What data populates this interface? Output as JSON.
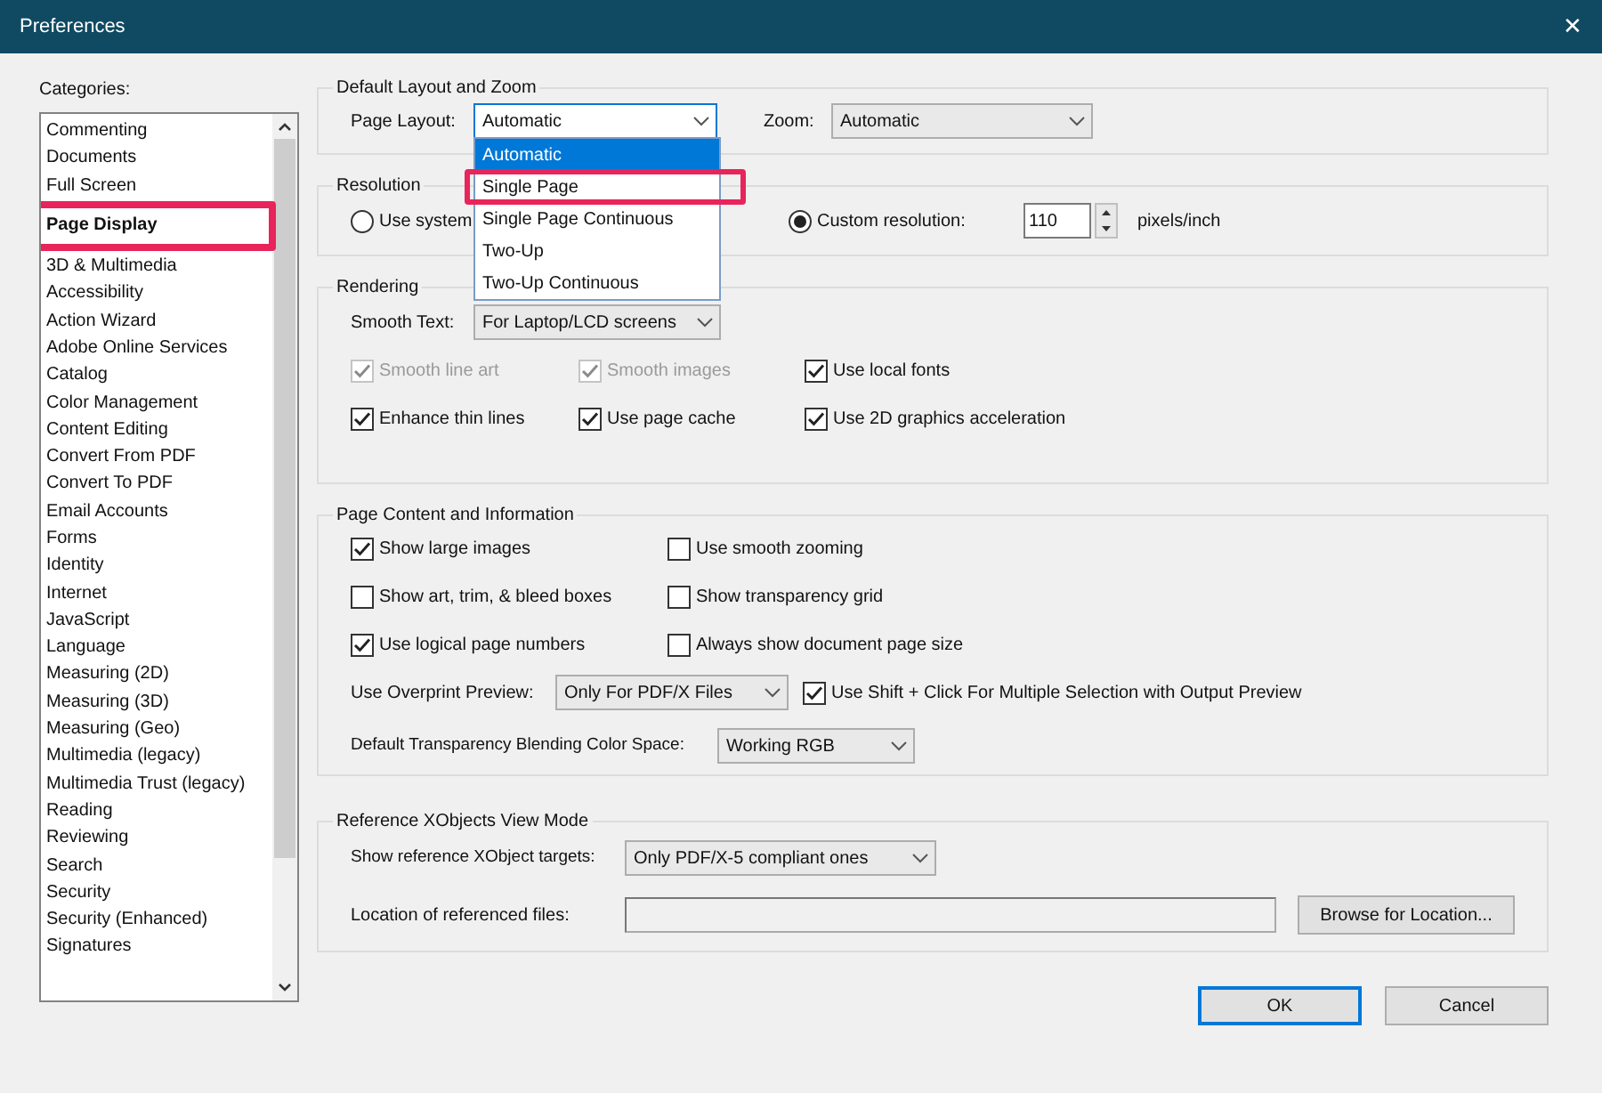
{
  "window": {
    "title": "Preferences",
    "close": "✕"
  },
  "categories": {
    "label": "Categories:",
    "items": [
      {
        "label": "Commenting",
        "selected": false
      },
      {
        "label": "Documents",
        "selected": false
      },
      {
        "label": "Full Screen",
        "selected": false
      },
      {
        "label": "Page Display",
        "selected": true,
        "highlighted": true
      },
      {
        "label": "3D & Multimedia",
        "selected": false
      },
      {
        "label": "Accessibility",
        "selected": false
      },
      {
        "label": "Action Wizard",
        "selected": false
      },
      {
        "label": "Adobe Online Services",
        "selected": false
      },
      {
        "label": "Catalog",
        "selected": false
      },
      {
        "label": "Color Management",
        "selected": false
      },
      {
        "label": "Content Editing",
        "selected": false
      },
      {
        "label": "Convert From PDF",
        "selected": false
      },
      {
        "label": "Convert To PDF",
        "selected": false
      },
      {
        "label": "Email Accounts",
        "selected": false
      },
      {
        "label": "Forms",
        "selected": false
      },
      {
        "label": "Identity",
        "selected": false
      },
      {
        "label": "Internet",
        "selected": false
      },
      {
        "label": "JavaScript",
        "selected": false
      },
      {
        "label": "Language",
        "selected": false
      },
      {
        "label": "Measuring (2D)",
        "selected": false
      },
      {
        "label": "Measuring (3D)",
        "selected": false
      },
      {
        "label": "Measuring (Geo)",
        "selected": false
      },
      {
        "label": "Multimedia (legacy)",
        "selected": false
      },
      {
        "label": "Multimedia Trust (legacy)",
        "selected": false
      },
      {
        "label": "Reading",
        "selected": false
      },
      {
        "label": "Reviewing",
        "selected": false
      },
      {
        "label": "Search",
        "selected": false
      },
      {
        "label": "Security",
        "selected": false
      },
      {
        "label": "Security (Enhanced)",
        "selected": false
      },
      {
        "label": "Signatures",
        "selected": false
      }
    ]
  },
  "layout_zoom": {
    "title": "Default Layout and Zoom",
    "page_layout_label": "Page Layout:",
    "page_layout_value": "Automatic",
    "zoom_label": "Zoom:",
    "zoom_value": "Automatic",
    "dropdown": {
      "expanded": true,
      "options": [
        {
          "label": "Automatic",
          "selected": true,
          "highlighted": false
        },
        {
          "label": "Single Page",
          "selected": false,
          "highlighted": true
        },
        {
          "label": "Single Page Continuous",
          "selected": false,
          "highlighted": false
        },
        {
          "label": "Two-Up",
          "selected": false,
          "highlighted": false
        },
        {
          "label": "Two-Up Continuous",
          "selected": false,
          "highlighted": false
        }
      ]
    }
  },
  "resolution": {
    "title": "Resolution",
    "options": [
      {
        "label": "Use system",
        "selected": false
      },
      {
        "label": "Custom resolution:",
        "selected": true
      }
    ],
    "value": "110",
    "unit": "pixels/inch"
  },
  "rendering": {
    "title": "Rendering",
    "smooth_text_label": "Smooth Text:",
    "smooth_text_value": "For Laptop/LCD screens",
    "checkboxes": [
      {
        "label": "Smooth line art",
        "checked": true,
        "disabled": true
      },
      {
        "label": "Smooth images",
        "checked": true,
        "disabled": true
      },
      {
        "label": "Use local fonts",
        "checked": true,
        "disabled": false
      },
      {
        "label": "Enhance thin lines",
        "checked": true,
        "disabled": false
      },
      {
        "label": "Use page cache",
        "checked": true,
        "disabled": false
      },
      {
        "label": "Use 2D graphics acceleration",
        "checked": true,
        "disabled": false
      }
    ]
  },
  "page_content": {
    "title": "Page Content and Information",
    "checkboxes": [
      {
        "label": "Show large images",
        "checked": true
      },
      {
        "label": "Use smooth zooming",
        "checked": false
      },
      {
        "label": "Show art, trim, & bleed boxes",
        "checked": false
      },
      {
        "label": "Show transparency grid",
        "checked": false
      },
      {
        "label": "Use logical page numbers",
        "checked": true
      },
      {
        "label": "Always show document page size",
        "checked": false
      }
    ],
    "overprint_label": "Use Overprint Preview:",
    "overprint_value": "Only For PDF/X Files",
    "shift_click": {
      "label": "Use Shift + Click For Multiple Selection with Output Preview",
      "checked": true
    },
    "blending_label": "Default Transparency Blending Color Space:",
    "blending_value": "Working RGB"
  },
  "xobjects": {
    "title": "Reference XObjects View Mode",
    "targets_label": "Show reference XObject targets:",
    "targets_value": "Only PDF/X-5 compliant ones",
    "location_label": "Location of referenced files:",
    "browse": "Browse for Location..."
  },
  "buttons": [
    {
      "label": "OK",
      "kind": "default"
    },
    {
      "label": "Cancel",
      "kind": "normal"
    }
  ]
}
